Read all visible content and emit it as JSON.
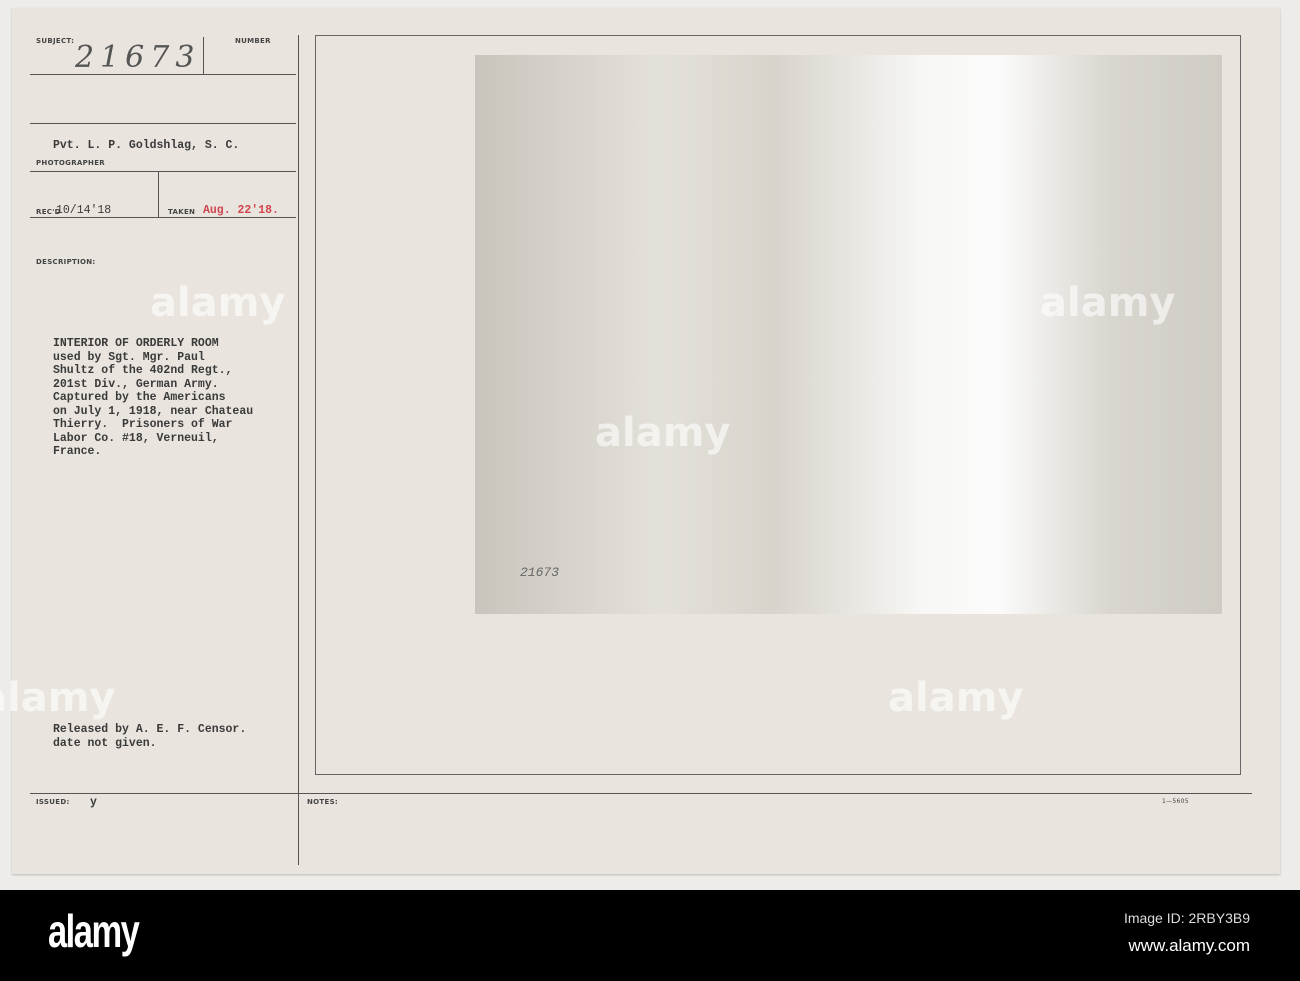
{
  "card": {
    "subject_label": "SUBJECT:",
    "number_label": "NUMBER",
    "number_value": "21673",
    "photographer": "Pvt. L. P. Goldshlag, S. C.",
    "photographer_label": "PHOTOGRAPHER",
    "rec_label": "REC'D",
    "rec_value": "10/14'18",
    "taken_label": "TAKEN",
    "taken_value": "Aug. 22'18.",
    "description_label": "DESCRIPTION:",
    "description": "INTERIOR OF ORDERLY ROOM\nused by Sgt. Mgr. Paul\nShultz of the 402nd Regt.,\n201st Div., German Army.\nCaptured by the Americans\non July 1, 1918, near Chateau\nThierry.  Prisoners of War\nLabor Co. #18, Verneuil,\nFrance.",
    "release": "Released by A. E. F. Censor.\ndate not given.",
    "issued_label": "ISSUED:",
    "issued_value": "y",
    "notes_label": "NOTES:",
    "form_code": "1—5605",
    "photo_stamp": "21673"
  },
  "watermark": {
    "logo": "alamy",
    "image_id": "Image ID: 2RBY3B9",
    "url": "www.alamy.com"
  }
}
